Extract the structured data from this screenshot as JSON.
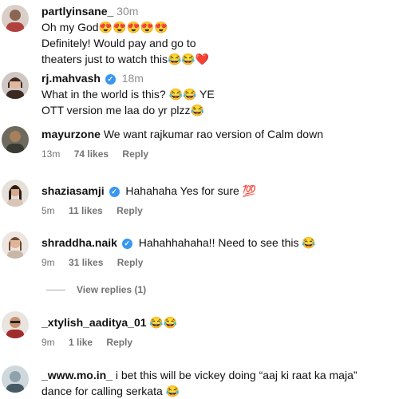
{
  "comments": [
    {
      "username": "partlyinsane_",
      "time": "30m",
      "verified": false,
      "lines": [
        "Oh my God😍😍😍😍😍",
        "Definitely! Would pay and go to",
        "theaters just to watch this😂😂❤️"
      ],
      "likes": "",
      "reply_label": ""
    },
    {
      "username": "rj.mahvash",
      "time": "18m",
      "verified": true,
      "lines": [
        "What in the world is this? 😂😂 YE",
        "OTT version me laa do yr plzz😂"
      ],
      "likes": "",
      "reply_label": ""
    },
    {
      "username": "mayurzone",
      "text": "We want rajkumar rao version of Calm down",
      "time": "13m",
      "likes": "74 likes",
      "reply_label": "Reply"
    },
    {
      "username": "shaziasamji",
      "verified": true,
      "text": "Hahahaha Yes for sure 💯",
      "time": "5m",
      "likes": "11 likes",
      "reply_label": "Reply"
    },
    {
      "username": "shraddha.naik",
      "verified": true,
      "text": "Hahahhahaha!! Need to see this 😂",
      "time": "9m",
      "likes": "31 likes",
      "reply_label": "Reply"
    },
    {
      "username": "_xtylish_aaditya_01",
      "text": "😂😂",
      "time": "9m",
      "likes": "1 like",
      "reply_label": "Reply"
    },
    {
      "username": "_www.mo.in_",
      "text": "i bet this will be vickey doing “aaj ki raat ka maja”",
      "text2": "dance for calling serkata 😂"
    }
  ],
  "view_replies": "View replies (1)",
  "verified_mark": "✓",
  "colors": {
    "verified": "#3897f0",
    "meta": "#737373",
    "text": "#111111"
  }
}
